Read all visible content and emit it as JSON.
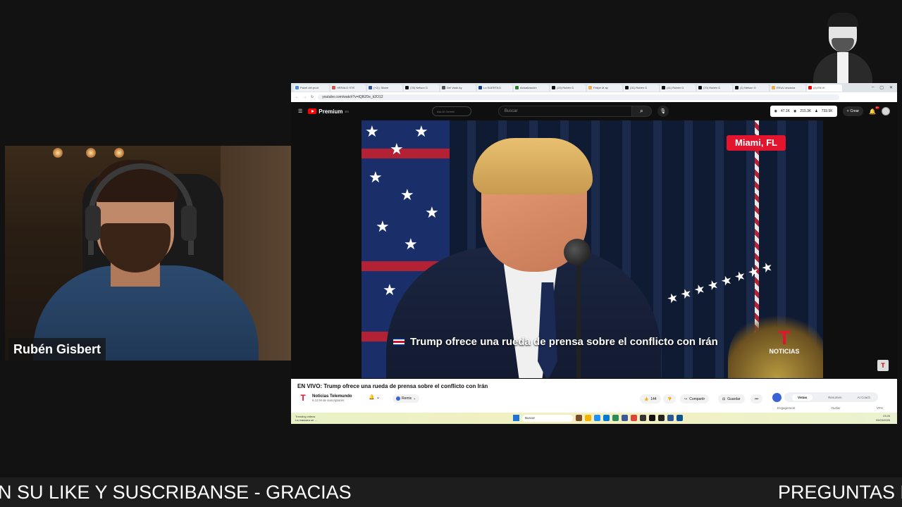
{
  "webcam": {
    "name_label": "Rubén Gisbert"
  },
  "browser": {
    "tabs": [
      {
        "label": "Panel del prod",
        "color": "#4a90d9"
      },
      {
        "label": "HERALD STE",
        "color": "#d9534f"
      },
      {
        "label": "(+2) | Share",
        "color": "#2b5797"
      },
      {
        "label": "(78) Nelson G",
        "color": "#111111"
      },
      {
        "label": "Del Vado Ay",
        "color": "#555555"
      },
      {
        "label": "Lo SUERTA D",
        "color": "#0b3d91"
      },
      {
        "label": "Actualización",
        "color": "#2e7d32"
      },
      {
        "label": "(20) Rubén G",
        "color": "#111111"
      },
      {
        "label": "Felipe M ap",
        "color": "#f0ad4e"
      },
      {
        "label": "(31) Rubén G",
        "color": "#111111"
      },
      {
        "label": "(41) Rubén G",
        "color": "#111111"
      },
      {
        "label": "(70) Rubén G",
        "color": "#111111"
      },
      {
        "label": "(1) Nelson G",
        "color": "#111111"
      },
      {
        "label": "EEUU anuncia",
        "color": "#f0ad4e"
      },
      {
        "label": "(4) EN VI",
        "color": "#ff0000"
      }
    ],
    "url": "youtube.com/watch?v=tQRZ0e_k2O12",
    "win_min": "–",
    "win_max": "▢",
    "win_close": "✕"
  },
  "youtube": {
    "logo_text": "Premium",
    "logo_sup": "ES",
    "ai_pill": "Ask AI Gemini",
    "search_placeholder": "Buscar",
    "stats": {
      "a": "47.1K",
      "b": "215.3K",
      "c": "733.5K"
    },
    "create_label": "Crear",
    "notif_count": "9+"
  },
  "video": {
    "location": "Miami, FL",
    "lower_third": "Trump ofrece una rueda de prensa sobre el conflicto con Irán",
    "network_logo_letter": "T",
    "network_name": "NOTICIAS"
  },
  "below_video": {
    "title": "EN VIVO: Trump ofrece una rueda de prensa sobre el conflicto con Irán",
    "channel_name": "Noticias Telemundo",
    "subscribers": "6,13 M de suscriptores",
    "remix_label": "Remix",
    "likes": "144",
    "share_label": "Compartir",
    "save_label": "Guardar",
    "more_label": "•••",
    "panel_tabs": [
      "Vistas",
      "Resumen",
      "AI Coach"
    ],
    "metric_labels": [
      "Engagement",
      "Outlier",
      "VPH"
    ]
  },
  "taskbar": {
    "weather_line1": "Trending videos",
    "weather_line2": "La mascara se ...",
    "search_text": "Buscar",
    "time": "23:26",
    "date": "09/03/2026",
    "icon_colors": [
      "#7a4d2a",
      "#f2b400",
      "#1e90ff",
      "#0078d4",
      "#2e8b57",
      "#3b5998",
      "#db4437",
      "#333333",
      "#111111",
      "#222222",
      "#2b5797",
      "#0b5394"
    ]
  },
  "ticker": {
    "text_left": "N SU LIKE Y SUSCRIBANSE - GRACIAS",
    "text_right": "PREGUNTAS F"
  }
}
